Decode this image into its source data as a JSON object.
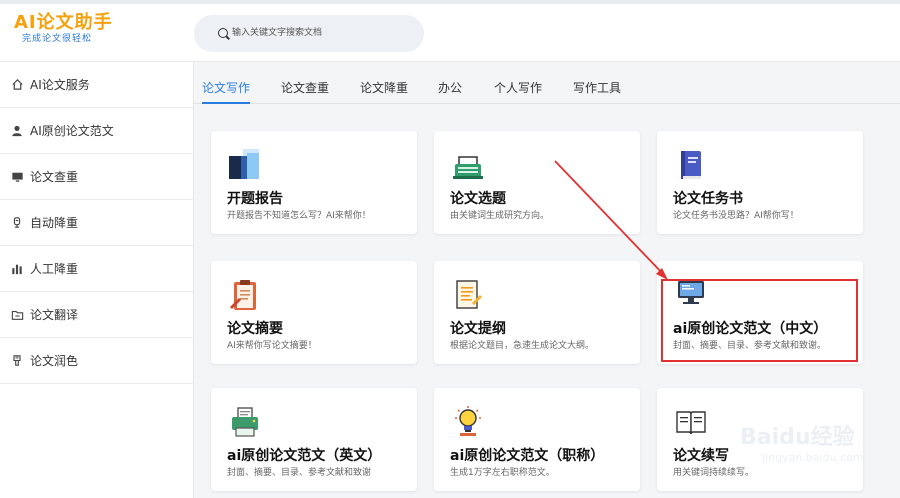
{
  "app": {
    "logo_title": "AI论文助手",
    "logo_subtitle": "完成论文很轻松"
  },
  "search": {
    "placeholder": "输入关键文字搜索文档"
  },
  "sidebar": {
    "items": [
      {
        "label": "AI论文服务",
        "icon": "home-icon"
      },
      {
        "label": "AI原创论文范文",
        "icon": "user-icon"
      },
      {
        "label": "论文查重",
        "icon": "monitor-icon"
      },
      {
        "label": "自动降重",
        "icon": "robot-icon"
      },
      {
        "label": "人工降重",
        "icon": "bar-chart-icon"
      },
      {
        "label": "论文翻译",
        "icon": "folder-icon"
      },
      {
        "label": "论文润色",
        "icon": "brush-icon"
      }
    ]
  },
  "tabs": {
    "items": [
      {
        "label": "论文写作",
        "active": true
      },
      {
        "label": "论文查重",
        "active": false
      },
      {
        "label": "论文降重",
        "active": false
      },
      {
        "label": "办公",
        "active": false
      },
      {
        "label": "个人写作",
        "active": false
      },
      {
        "label": "写作工具",
        "active": false
      }
    ]
  },
  "cards": [
    {
      "title": "开题报告",
      "desc": "开题报告不知道怎么写？AI来帮你！",
      "icon": "report-icon"
    },
    {
      "title": "论文选题",
      "desc": "由关键词生成研究方向。",
      "icon": "typewriter-icon"
    },
    {
      "title": "论文任务书",
      "desc": "论文任务书没思路？AI帮你写！",
      "icon": "book-icon"
    },
    {
      "title": "论文摘要",
      "desc": "AI来帮你写论文摘要！",
      "icon": "clipboard-icon"
    },
    {
      "title": "论文提纲",
      "desc": "根据论文题目，急速生成论文大纲。",
      "icon": "outline-icon"
    },
    {
      "title": "ai原创论文范文（中文）",
      "desc": "封面、摘要、目录、参考文献和致谢。",
      "icon": "computer-icon"
    },
    {
      "title": "ai原创论文范文（英文）",
      "desc": "封面、摘要、目录、参考文献和致谢",
      "icon": "printer-icon"
    },
    {
      "title": "ai原创论文范文（职称）",
      "desc": "生成1万字左右职称范文。",
      "icon": "lightbulb-icon"
    },
    {
      "title": "论文续写",
      "desc": "用关键词持续续写。",
      "icon": "open-book-icon"
    }
  ],
  "watermark": {
    "text": "Baidu经验",
    "url": "jingyan.baidu.com"
  },
  "colors": {
    "accent": "#2a7de1",
    "logo": "#f5a10c",
    "highlight": "#e03232"
  }
}
